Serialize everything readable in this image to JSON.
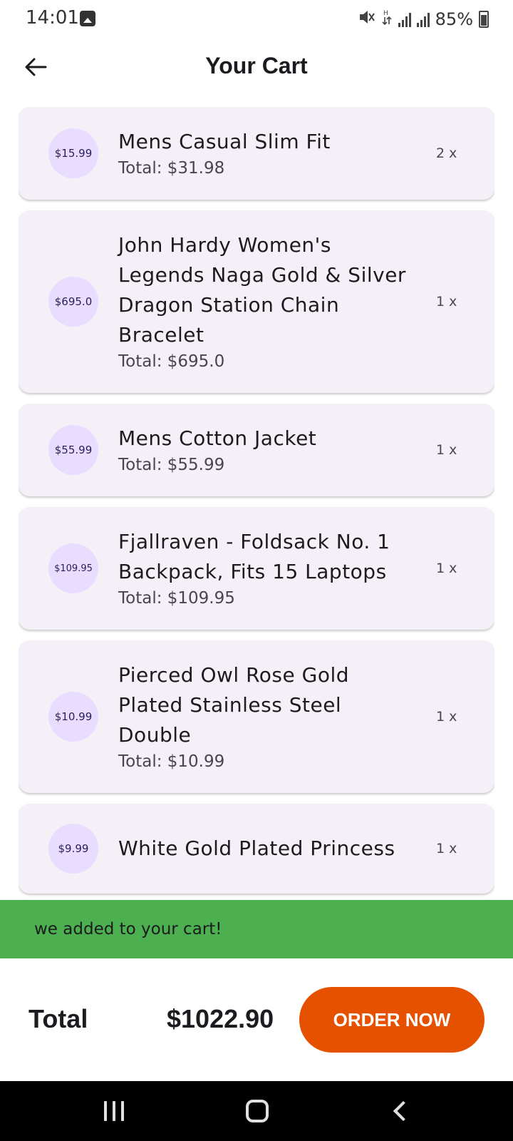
{
  "status_bar": {
    "time": "14:01",
    "battery": "85%",
    "icons": [
      "gallery-icon",
      "mute-icon",
      "data-arrows-icon",
      "signal-icon",
      "signal-icon",
      "battery-icon"
    ]
  },
  "app_bar": {
    "title": "Your Cart",
    "back_icon": "arrow-left-icon"
  },
  "cart": {
    "items": [
      {
        "price": "$15.99",
        "title": "Mens Casual Slim Fit",
        "total": "Total: $31.98",
        "qty": "2 x"
      },
      {
        "price": "$695.0",
        "title": "John Hardy Women's Legends Naga Gold & Silver Dragon Station Chain Bracelet",
        "total": "Total: $695.0",
        "qty": "1 x"
      },
      {
        "price": "$55.99",
        "title": "Mens Cotton Jacket",
        "total": "Total: $55.99",
        "qty": "1 x"
      },
      {
        "price": "$109.95",
        "title": "Fjallraven - Foldsack No. 1 Backpack, Fits 15 Laptops",
        "total": "Total: $109.95",
        "qty": "1 x"
      },
      {
        "price": "$10.99",
        "title": "Pierced Owl Rose Gold Plated Stainless Steel Double",
        "total": "Total: $10.99",
        "qty": "1 x"
      },
      {
        "price": "$9.99",
        "title": "White Gold Plated Princess",
        "total": "",
        "qty": "1 x"
      }
    ]
  },
  "snackbar": {
    "message": "we added to your cart!"
  },
  "summary": {
    "total_label": "Total",
    "total_value": "$1022.90",
    "order_button": "ORDER NOW"
  },
  "colors": {
    "card_bg": "#f5f0f7",
    "avatar_bg": "#e9ddff",
    "snackbar_bg": "#4caf50",
    "order_button_bg": "#e65100"
  }
}
